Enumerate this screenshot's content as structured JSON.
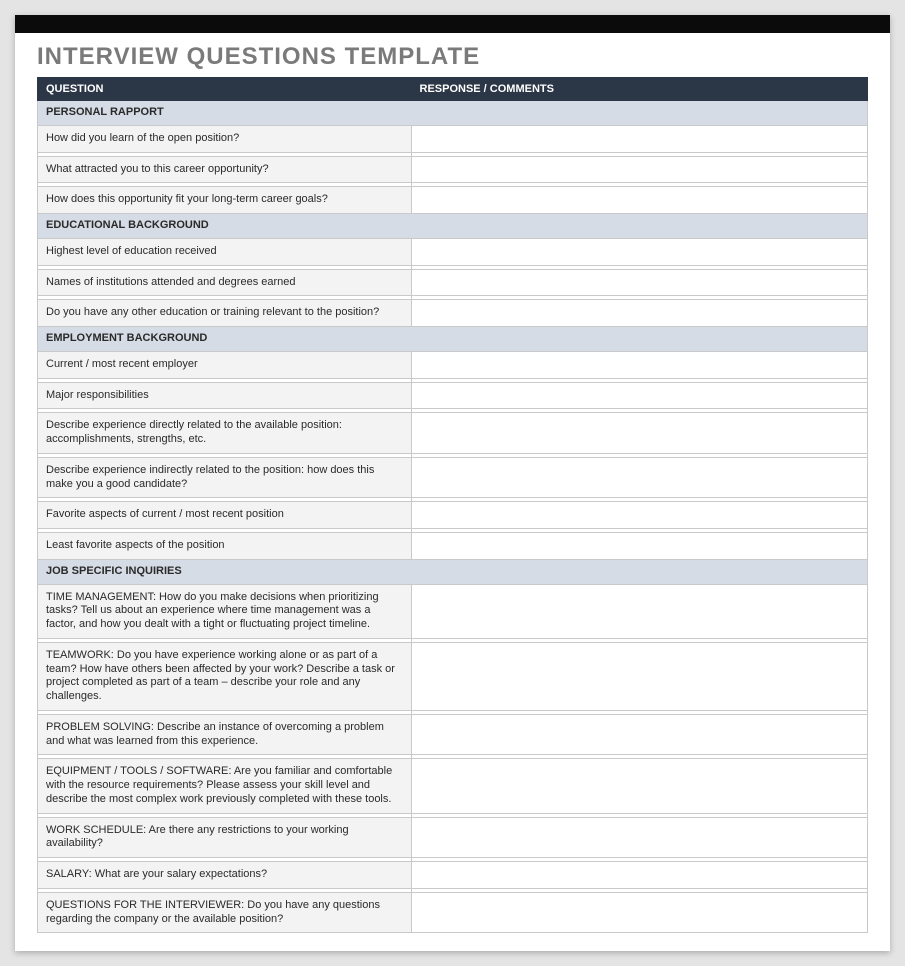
{
  "title": "INTERVIEW QUESTIONS TEMPLATE",
  "headers": {
    "question": "QUESTION",
    "response": "RESPONSE / COMMENTS"
  },
  "sections": [
    {
      "title": "PERSONAL RAPPORT",
      "questions": [
        "How did you learn of the open position?",
        "What attracted you to this career opportunity?",
        "How does this opportunity fit your long-term career goals?"
      ]
    },
    {
      "title": "EDUCATIONAL BACKGROUND",
      "questions": [
        "Highest level of education received",
        "Names of institutions attended and degrees earned",
        "Do you have any other education or training relevant to the position?"
      ]
    },
    {
      "title": "EMPLOYMENT BACKGROUND",
      "questions": [
        "Current / most recent employer",
        "Major responsibilities",
        "Describe experience directly related to the available position: accomplishments, strengths, etc.",
        "Describe experience indirectly related to the position: how does this make you a good candidate?",
        "Favorite aspects of current / most recent position",
        "Least favorite aspects of the position"
      ]
    },
    {
      "title": "JOB SPECIFIC INQUIRIES",
      "questions": [
        "TIME MANAGEMENT: How do you make decisions when prioritizing tasks? Tell us about an experience where time management was a factor, and how you dealt with a tight or fluctuating project timeline.",
        "TEAMWORK: Do you have experience working alone or as part of a team? How have others been affected by your work? Describe a task or project completed as part of a team – describe your role and any challenges.",
        "PROBLEM SOLVING: Describe an instance of overcoming a problem and what was learned from this experience.",
        "EQUIPMENT / TOOLS / SOFTWARE: Are you familiar and comfortable with the resource requirements? Please assess your skill level and describe the most complex work previously completed with these tools.",
        "WORK SCHEDULE: Are there any restrictions to your working availability?",
        "SALARY: What are your salary expectations?",
        "QUESTIONS FOR THE INTERVIEWER: Do you have any questions regarding the company or the available position?"
      ]
    }
  ]
}
